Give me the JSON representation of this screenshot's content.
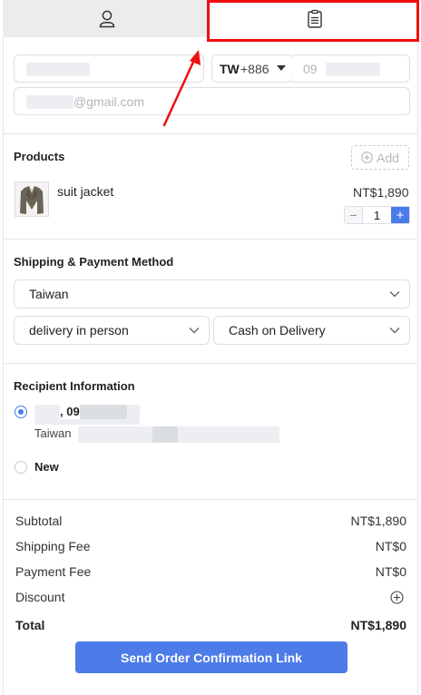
{
  "tabs": [
    {
      "label": "customer",
      "icon": "user-icon"
    },
    {
      "label": "order",
      "icon": "clipboard-icon"
    }
  ],
  "contact": {
    "country_code": "TW",
    "dial_code": "+886",
    "phone_prefix": "09",
    "email_suffix": "@gmail.com"
  },
  "products": {
    "title": "Products",
    "add_label": "Add",
    "items": [
      {
        "name": "suit jacket",
        "price": "NT$1,890",
        "quantity": "1"
      }
    ]
  },
  "shipping": {
    "title": "Shipping & Payment Method",
    "country": "Taiwan",
    "delivery": "delivery in person",
    "payment": "Cash on Delivery"
  },
  "recipient": {
    "title": "Recipient Information",
    "saved_phone_prefix": ", 09",
    "saved_country": "Taiwan",
    "new_label": "New"
  },
  "summary": {
    "subtotal_label": "Subtotal",
    "subtotal_value": "NT$1,890",
    "shipping_label": "Shipping Fee",
    "shipping_value": "NT$0",
    "payment_label": "Payment Fee",
    "payment_value": "NT$0",
    "discount_label": "Discount",
    "total_label": "Total",
    "total_value": "NT$1,890"
  },
  "send_button": "Send Order Confirmation Link",
  "colors": {
    "accent": "#4d7be8",
    "highlight": "#f20d0d",
    "tab_inactive": "#ececec"
  }
}
